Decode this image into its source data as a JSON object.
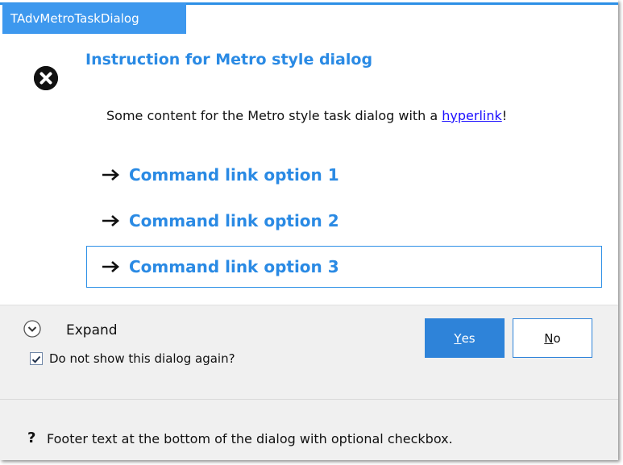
{
  "window": {
    "title": "TAdvMetroTaskDialog"
  },
  "instruction": "Instruction for Metro style dialog",
  "content": {
    "text_before": "Some content for the Metro style task dialog with a ",
    "link_text": "hyperlink",
    "text_after": "!"
  },
  "command_links": [
    {
      "label": "Command link option 1",
      "selected": false
    },
    {
      "label": "Command link option 2",
      "selected": false
    },
    {
      "label": "Command link option 3",
      "selected": true
    }
  ],
  "expand": {
    "label": "Expand"
  },
  "verification": {
    "label": "Do not show this dialog again?",
    "checked": true
  },
  "buttons": {
    "yes": {
      "accel": "Y",
      "rest": "es"
    },
    "no": {
      "accel": "N",
      "rest": "o"
    }
  },
  "footer": {
    "icon": "?",
    "text": "Footer text at the bottom of the dialog with optional checkbox."
  },
  "icons": {
    "main": "error-icon",
    "command": "arrow-right-icon",
    "expand": "chevron-down-icon",
    "footer": "question-icon"
  },
  "colors": {
    "accent": "#3d98ee",
    "instruction": "#2a8ae4",
    "link": "#1a0dff",
    "button_primary": "#2e83d9",
    "panel": "#f0f0f0"
  }
}
